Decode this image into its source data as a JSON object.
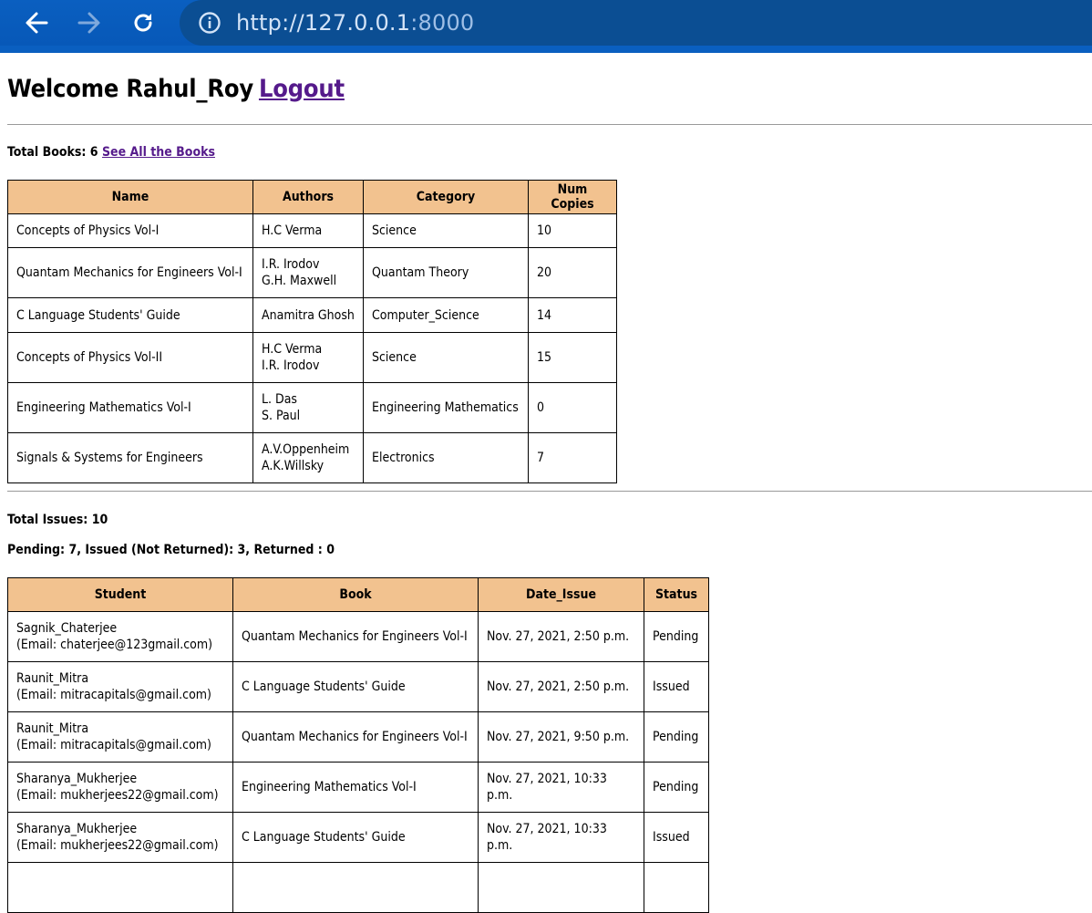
{
  "browser": {
    "url_host": "http://127.0.0.1",
    "url_port": ":8000"
  },
  "header": {
    "welcome": "Welcome Rahul_Roy",
    "logout": "Logout"
  },
  "books": {
    "total_label": "Total Books: 6",
    "see_all": "See All the Books",
    "columns": [
      "Name",
      "Authors",
      "Category",
      "Num Copies"
    ],
    "rows": [
      {
        "name": "Concepts of Physics Vol-I",
        "authors": [
          "H.C Verma"
        ],
        "category": "Science",
        "copies": "10"
      },
      {
        "name": "Quantam Mechanics for Engineers Vol-I",
        "authors": [
          "I.R. Irodov",
          "G.H. Maxwell"
        ],
        "category": "Quantam Theory",
        "copies": "20"
      },
      {
        "name": "C Language Students' Guide",
        "authors": [
          "Anamitra Ghosh"
        ],
        "category": "Computer_Science",
        "copies": "14"
      },
      {
        "name": "Concepts of Physics Vol-II",
        "authors": [
          "H.C Verma",
          "I.R. Irodov"
        ],
        "category": "Science",
        "copies": "15"
      },
      {
        "name": "Engineering Mathematics Vol-I",
        "authors": [
          "L. Das",
          "S. Paul"
        ],
        "category": "Engineering Mathematics",
        "copies": "0"
      },
      {
        "name": "Signals & Systems for Engineers",
        "authors": [
          "A.V.Oppenheim",
          "A.K.Willsky"
        ],
        "category": "Electronics",
        "copies": "7"
      }
    ]
  },
  "issues": {
    "total_label": "Total Issues: 10",
    "summary": "Pending: 7, Issued (Not Returned): 3, Returned : 0",
    "columns": [
      "Student",
      "Book",
      "Date_Issue",
      "Status"
    ],
    "rows": [
      {
        "student": "Sagnik_Chaterjee",
        "email": "(Email: chaterjee@123gmail.com)",
        "book": "Quantam Mechanics for Engineers Vol-I",
        "date": "Nov. 27, 2021, 2:50 p.m.",
        "status": "Pending"
      },
      {
        "student": "Raunit_Mitra",
        "email": "(Email: mitracapitals@gmail.com)",
        "book": "C Language Students' Guide",
        "date": "Nov. 27, 2021, 2:50 p.m.",
        "status": "Issued"
      },
      {
        "student": "Raunit_Mitra",
        "email": "(Email: mitracapitals@gmail.com)",
        "book": "Quantam Mechanics for Engineers Vol-I",
        "date": "Nov. 27, 2021, 9:50 p.m.",
        "status": "Pending"
      },
      {
        "student": "Sharanya_Mukherjee",
        "email": "(Email: mukherjees22@gmail.com)",
        "book": "Engineering Mathematics Vol-I",
        "date": "Nov. 27, 2021, 10:33 p.m.",
        "status": "Pending"
      },
      {
        "student": "Sharanya_Mukherjee",
        "email": "(Email: mukherjees22@gmail.com)",
        "book": "C Language Students' Guide",
        "date": "Nov. 27, 2021, 10:33 p.m.",
        "status": "Issued"
      }
    ]
  }
}
